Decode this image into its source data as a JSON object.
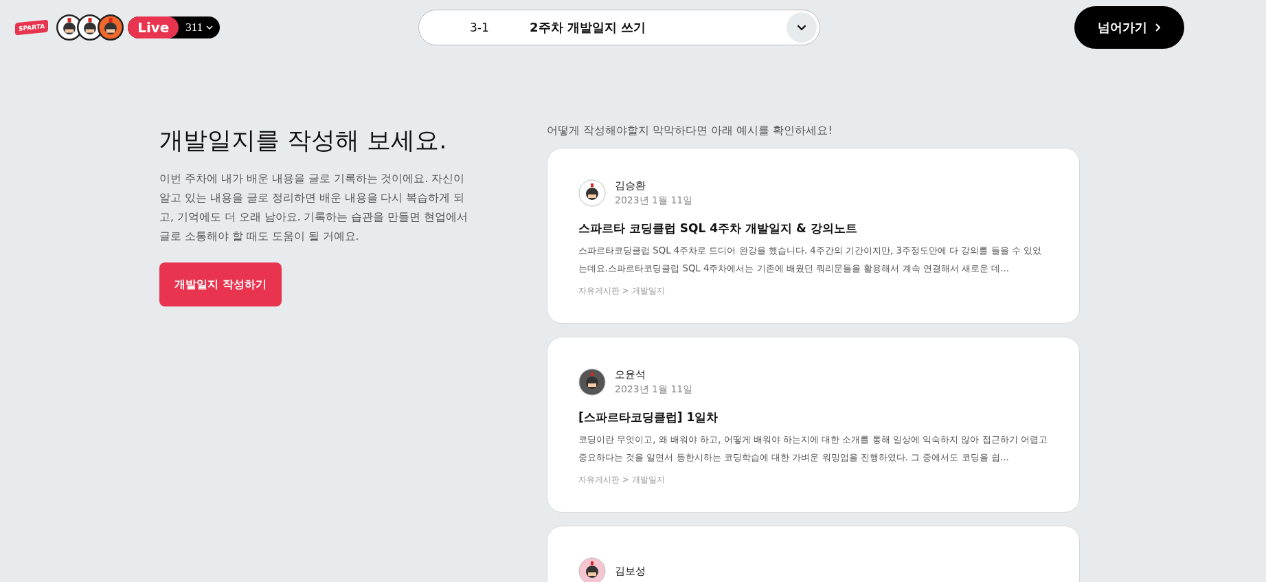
{
  "header": {
    "logo": "SPARTA",
    "live_label": "Live",
    "viewer_count": "311",
    "lesson": {
      "number": "3-1",
      "title": "2주차 개발일지 쓰기"
    },
    "skip_button": "넘어가기"
  },
  "intro": {
    "heading": "개발일지를 작성해 보세요.",
    "description": "이번 주차에 내가 배운 내용을 글로 기록하는 것이에요. 자신이 알고 있는 내용을 글로 정리하면 배운 내용을 다시 복습하게 되고, 기억에도 더 오래 남아요. 기록하는 습관을 만들면 현업에서 글로 소통해야 할 때도 도움이 될 거예요.",
    "write_button": "개발일지 작성하기"
  },
  "examples": {
    "hint": "어떻게 작성해야할지 막막하다면 아래 예시를 확인하세요!",
    "posts": [
      {
        "author": "김승환",
        "date": "2023년 1월 11일",
        "title": "스파르타 코딩클럽 SQL 4주차 개발일지 & 강의노트",
        "excerpt": "스파르타코딩클럽 SQL 4주차로 드디어 완강을 했습니다. 4주간의 기간이지만, 3주정도만에 다 강의를 들을 수 있었는데요.스파르타코딩클럽 SQL 4주차에서는 기존에 배웠던 쿼리문들을 활용해서 계속 연결해서 새로운 데...",
        "category": "자유게시판 > 개발일지"
      },
      {
        "author": "오윤석",
        "date": "2023년 1월 11일",
        "title": "[스파르타코딩클럽] 1일차",
        "excerpt": "코딩이란 무엇이고, 왜 배워야 하고, 어떻게 배워야 하는지에 대한 소개를 통해 일상에 익숙하지 않아 접근하기 어렵고 중요하다는 것을 알면서 등한시하는 코딩학습에 대한 가벼운 워밍업을 진행하였다. 그 중에서도 코딩을 쉽...",
        "category": "자유게시판 > 개발일지"
      },
      {
        "author": "김보성"
      }
    ]
  }
}
